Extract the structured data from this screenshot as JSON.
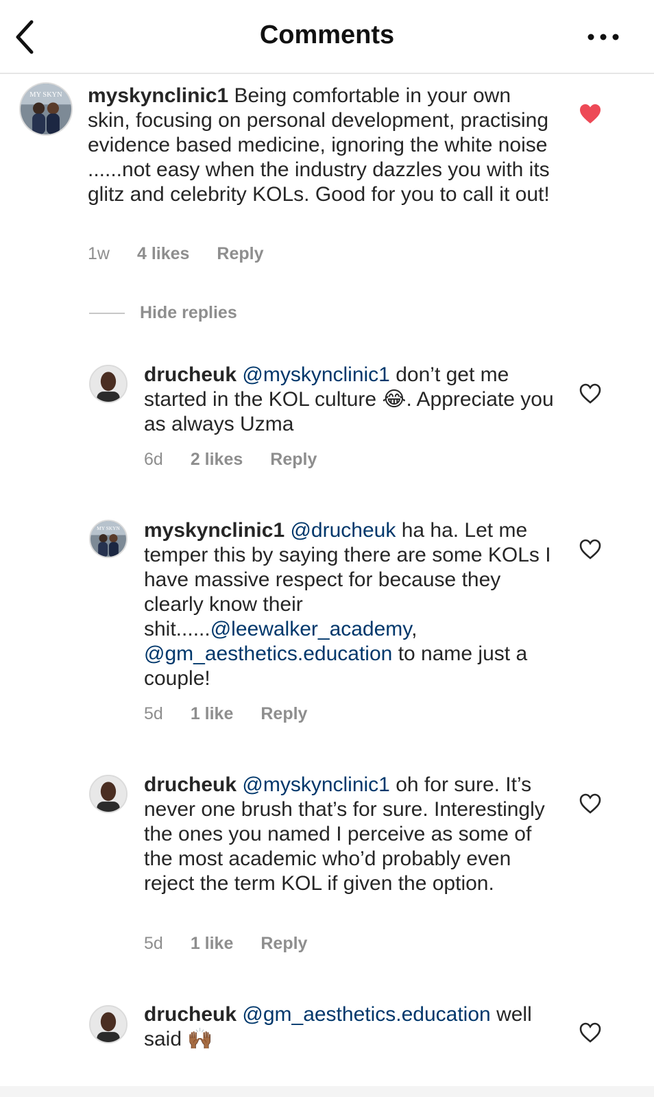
{
  "header": {
    "title": "Comments",
    "back_icon": "chevron-left-icon",
    "more_icon": "more-horizontal-icon"
  },
  "colors": {
    "text": "#262626",
    "secondary": "#8e8e8e",
    "mention": "#00376b",
    "liked_heart": "#ed4956"
  },
  "comments": [
    {
      "username": "myskynclinic1",
      "mention": "",
      "text": "Being comfortable in your own skin, focusing on personal development, practising evidence based medicine,  ignoring the white noise ......not easy  when the industry dazzles you with its glitz and celebrity KOLs. Good for you to call it out!",
      "time": "1w",
      "likes": "4 likes",
      "reply": "Reply",
      "liked": true,
      "avatar_text": "MY SKYN"
    }
  ],
  "hide_replies": "Hide replies",
  "replies": [
    {
      "username": "drucheuk",
      "mention": "@myskynclinic1",
      "text_before_emoji": "don’t get me started in the KOL culture",
      "emoji": "😂",
      "text_after_emoji": ". Appreciate you as always Uzma",
      "time": "6d",
      "likes": "2 likes",
      "reply": "Reply"
    },
    {
      "username": "myskynclinic1",
      "mention": "@drucheuk",
      "text1": "ha ha. Let me temper this by saying there are some KOLs I have massive respect for because they clearly know their shit......",
      "mention2": "@leewalker_academy",
      "text2": ",",
      "mention3": "@gm_aesthetics.education",
      "text3": "to name just a couple!",
      "time": "5d",
      "likes": "1 like",
      "reply": "Reply",
      "avatar_text": "MY SKYN"
    },
    {
      "username": "drucheuk",
      "mention": "@myskynclinic1",
      "text": "oh for sure. It’s never one brush that’s for sure. Interestingly the ones you named I perceive as some of the most academic who’d probably even reject the term KOL if given the option.",
      "time": "5d",
      "likes": "1 like",
      "reply": "Reply"
    },
    {
      "username": "drucheuk",
      "mention": "@gm_aesthetics.education",
      "text": "well said",
      "emoji": "🙌🏾"
    }
  ]
}
